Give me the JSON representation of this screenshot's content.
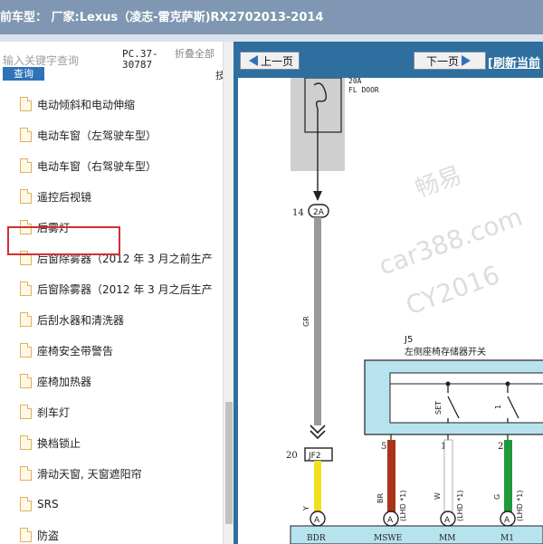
{
  "window": {
    "title": "前车型： 厂家:Lexus（凌志-雷克萨斯)RX2702013-2014"
  },
  "search": {
    "placeholder": "输入关键字查询",
    "button": "查询",
    "code": "PC.37-30787",
    "collapse": "折叠全部",
    "extra": "技"
  },
  "tree": {
    "items": [
      "电动倾斜和电动伸缩",
      "电动车窗（左驾驶车型）",
      "电动车窗（右驾驶车型）",
      "遥控后视镜",
      "后雾灯",
      "后窗除雾器（2012 年 3 月之前生产",
      "后窗除雾器（2012 年 3 月之后生产",
      "后刮水器和清洗器",
      "座椅安全带警告",
      "座椅加热器",
      "刹车灯",
      "换档锁止",
      "滑动天窗, 天窗遮阳帘",
      "SRS",
      "防盗"
    ],
    "selected": "遥控后视镜"
  },
  "toolbar": {
    "prev": "上一页",
    "next": "下一页",
    "refresh": "[刷新当前"
  },
  "diagram": {
    "fuse": "20A",
    "fuse_name": "FL DOOR",
    "conn_top_pin": "14",
    "conn_top": "2A",
    "wire_gr": "GR",
    "conn_mid_pin": "20",
    "conn_mid": "JF2",
    "wire_y": "Y",
    "switch_id": "J5",
    "switch_name": "左侧座椅存储器开关",
    "sw_set": "SET",
    "sw_1": "1",
    "pins": [
      "5",
      "1",
      "2"
    ],
    "wires": [
      {
        "name": "BR",
        "note": "(LHD *1)",
        "color": "#a8341a"
      },
      {
        "name": "W",
        "note": "(LHD *1)",
        "color": "#ffffff"
      },
      {
        "name": "G",
        "note": "(LHD *1)",
        "color": "#1f9a3a"
      }
    ],
    "bottom_pins": [
      "14",
      "13",
      "1",
      "2"
    ],
    "bottom_conn": "A",
    "bottom_labels": [
      "BDR",
      "MSWE",
      "MM",
      "M1"
    ],
    "watermark": [
      "畅易",
      "car388.com",
      "CY2016"
    ]
  }
}
